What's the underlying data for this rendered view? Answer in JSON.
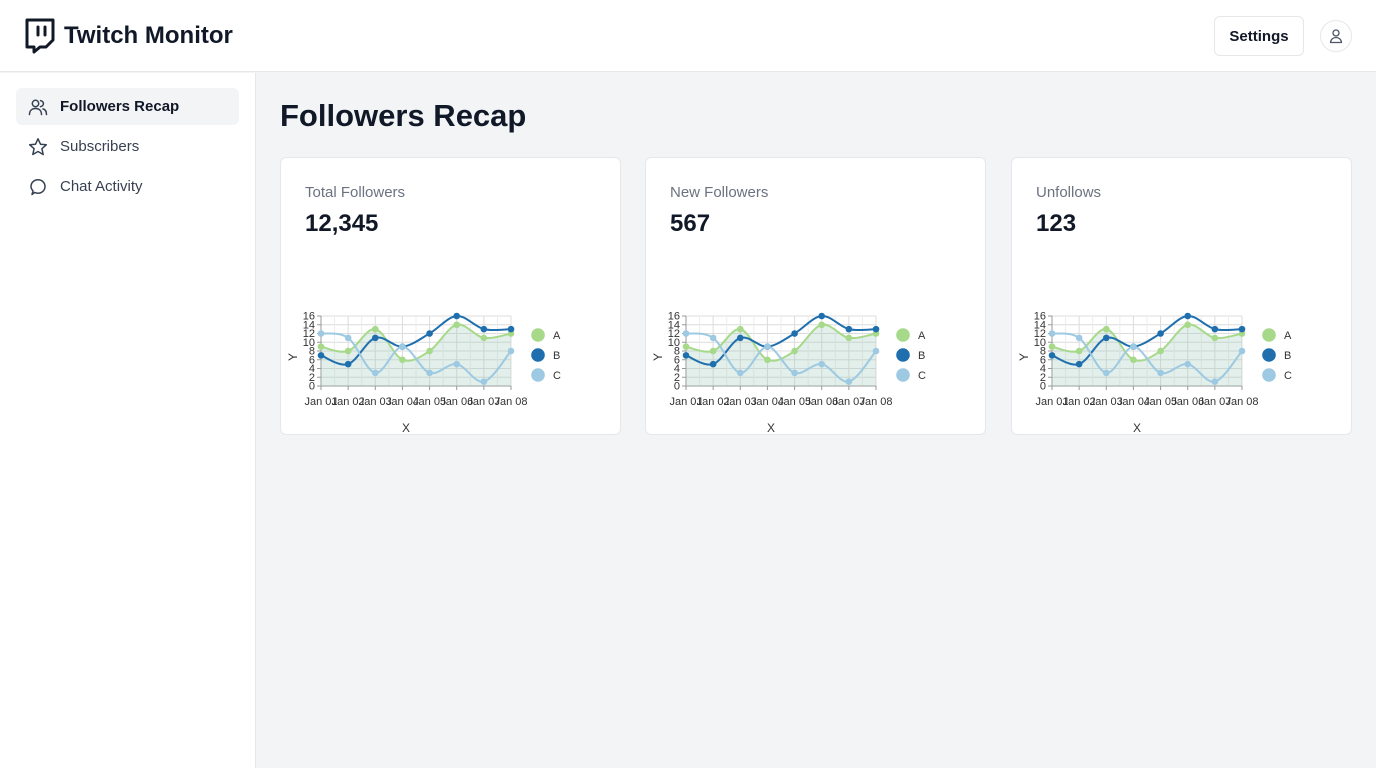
{
  "app": {
    "title": "Twitch Monitor"
  },
  "header": {
    "settings_label": "Settings"
  },
  "sidebar": {
    "items": [
      {
        "label": "Followers Recap",
        "icon": "users-icon",
        "active": true
      },
      {
        "label": "Subscribers",
        "icon": "star-icon",
        "active": false
      },
      {
        "label": "Chat Activity",
        "icon": "chat-bubble-icon",
        "active": false
      }
    ]
  },
  "page": {
    "title": "Followers Recap"
  },
  "cards": [
    {
      "label": "Total Followers",
      "value": "12,345"
    },
    {
      "label": "New Followers",
      "value": "567"
    },
    {
      "label": "Unfollows",
      "value": "123"
    }
  ],
  "colors": {
    "A": "#a6d98a",
    "B": "#1f6fae",
    "C": "#9ec9e2",
    "sidebar_active_bg": "#f3f4f6",
    "page_bg": "#f3f4f6"
  },
  "chart_data": {
    "type": "line",
    "categories": [
      "Jan 01",
      "Jan 02",
      "Jan 03",
      "Jan 04",
      "Jan 05",
      "Jan 06",
      "Jan 07",
      "Jan 08"
    ],
    "series": [
      {
        "name": "A",
        "values": [
          9,
          8,
          13,
          6,
          8,
          14,
          11,
          12
        ]
      },
      {
        "name": "B",
        "values": [
          7,
          5,
          11,
          9,
          12,
          16,
          13,
          13
        ]
      },
      {
        "name": "C",
        "values": [
          12,
          11,
          3,
          9,
          3,
          5,
          1,
          8
        ]
      }
    ],
    "yticks": [
      0,
      2,
      4,
      6,
      8,
      10,
      12,
      14,
      16
    ],
    "ylim": [
      0,
      16
    ],
    "xlabel": "X",
    "ylabel": "Y",
    "grid": true,
    "legend": "right"
  }
}
